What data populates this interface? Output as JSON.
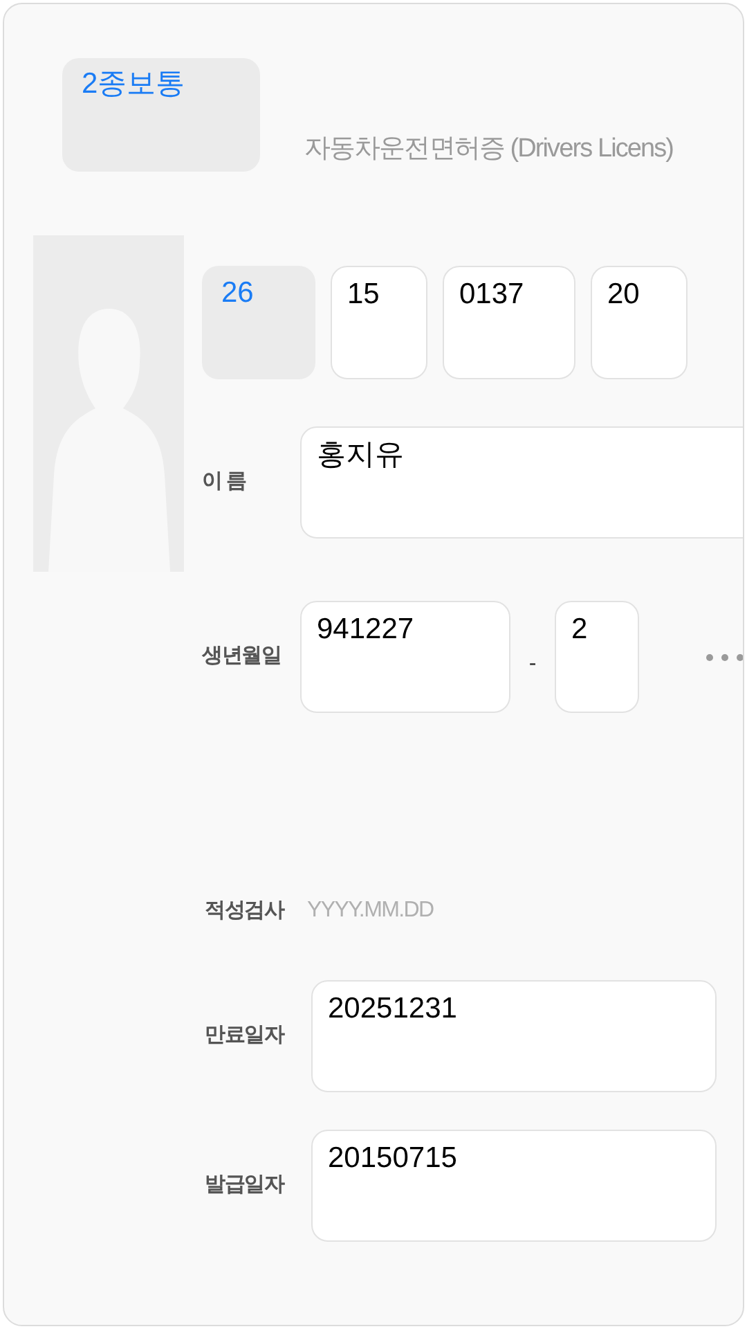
{
  "license_class": {
    "text": "2종보통"
  },
  "title": "자동차운전면허증 (Drivers Licens)",
  "license_number": [
    {
      "kind": "region",
      "text": "26"
    },
    {
      "kind": "field",
      "text": "15"
    },
    {
      "kind": "field",
      "text": "0137"
    },
    {
      "kind": "field",
      "text": "20"
    }
  ],
  "name": {
    "label": "이 름",
    "value": "홍지유"
  },
  "birth": {
    "label": "생년월일",
    "value_front": "941227",
    "separator": "-",
    "value_back": "2"
  },
  "aptitude_test": {
    "label": "적성검사",
    "placeholder": "YYYY.MM.DD"
  },
  "expiry": {
    "label": "만료일자",
    "value": "20251231"
  },
  "issue": {
    "label": "발급일자",
    "value": "20150715"
  }
}
